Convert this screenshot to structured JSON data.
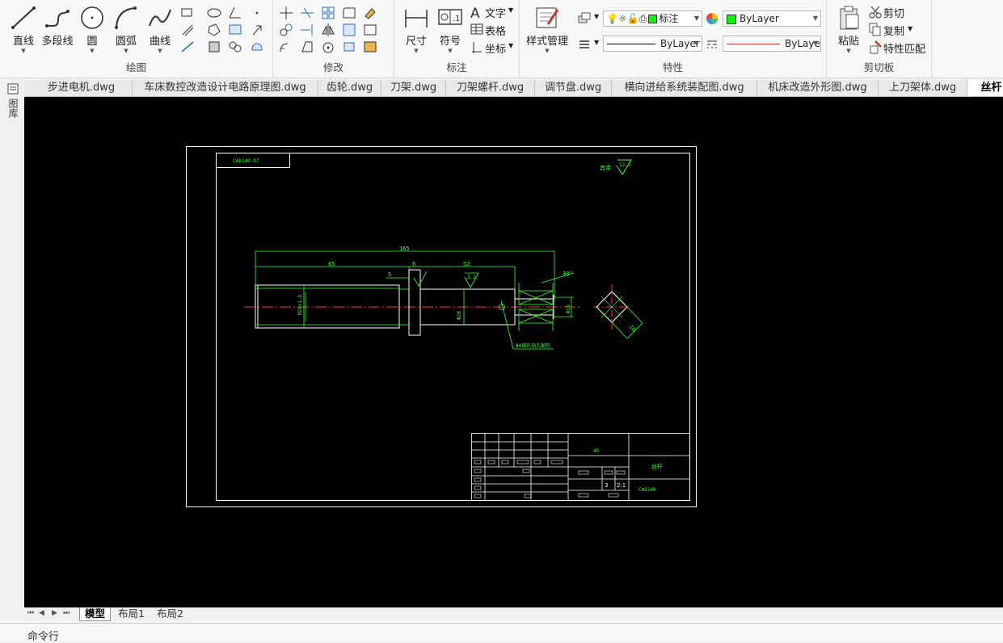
{
  "ribbon": {
    "draw": {
      "label": "绘图",
      "tools": [
        "直线",
        "多段线",
        "圆",
        "圆弧",
        "曲线"
      ]
    },
    "modify": {
      "label": "修改"
    },
    "annotate": {
      "label": "标注",
      "dimension": "尺寸",
      "symbol": "符号",
      "text": "文字",
      "table": "表格",
      "coordinate": "坐标"
    },
    "properties": {
      "label": "特性",
      "style_manager": "样式管理",
      "layer": "标注",
      "color": "ByLayer",
      "linetype": "ByLayer",
      "lineweight": "ByLayer",
      "color_hex": "#00ff00"
    },
    "clipboard": {
      "label": "剪切板",
      "paste": "粘贴",
      "cut": "剪切",
      "copy": "复制",
      "match": "特性匹配"
    }
  },
  "left_strip": {
    "label": "图库"
  },
  "doc_tabs": [
    "步进电机.dwg",
    "车床数控改造设计电路原理图.dwg",
    "齿轮.dwg",
    "刀架.dwg",
    "刀架螺杆.dwg",
    "调节盘.dwg",
    "横向进给系统装配图.dwg",
    "机床改造外形图.dwg",
    "上刀架体.dwg",
    "丝杆"
  ],
  "active_doc_tab": 9,
  "layout_tabs": [
    "模型",
    "布局1",
    "布局2"
  ],
  "active_layout": 0,
  "command_line": {
    "label": "命令行"
  },
  "drawing": {
    "code_label": "CA6140-07",
    "roughness_note": "其余",
    "roughness_value": "12.5",
    "dim_total": "165",
    "dim_85": "85",
    "dim_6": "6",
    "dim_52": "52",
    "dim_5": "5",
    "dim_30deg": "30°",
    "dim_thread": "M20×1.5",
    "dim_d20": "Φ20",
    "dim_d16": "Φ16",
    "dim_16": "16",
    "hole_note": "Φ4销孔钻孔配作",
    "roughness_32": "3.2",
    "title_block_scale": "2:1",
    "title_block_count": "3",
    "title_block_name": "丝杆",
    "title_block_material": "45",
    "title_block_code": "CA6140"
  },
  "colors": {
    "canvas": "#000000",
    "drawing_lines": "#00ff00",
    "frame": "#ffffff",
    "centerline": "#ff0000"
  }
}
